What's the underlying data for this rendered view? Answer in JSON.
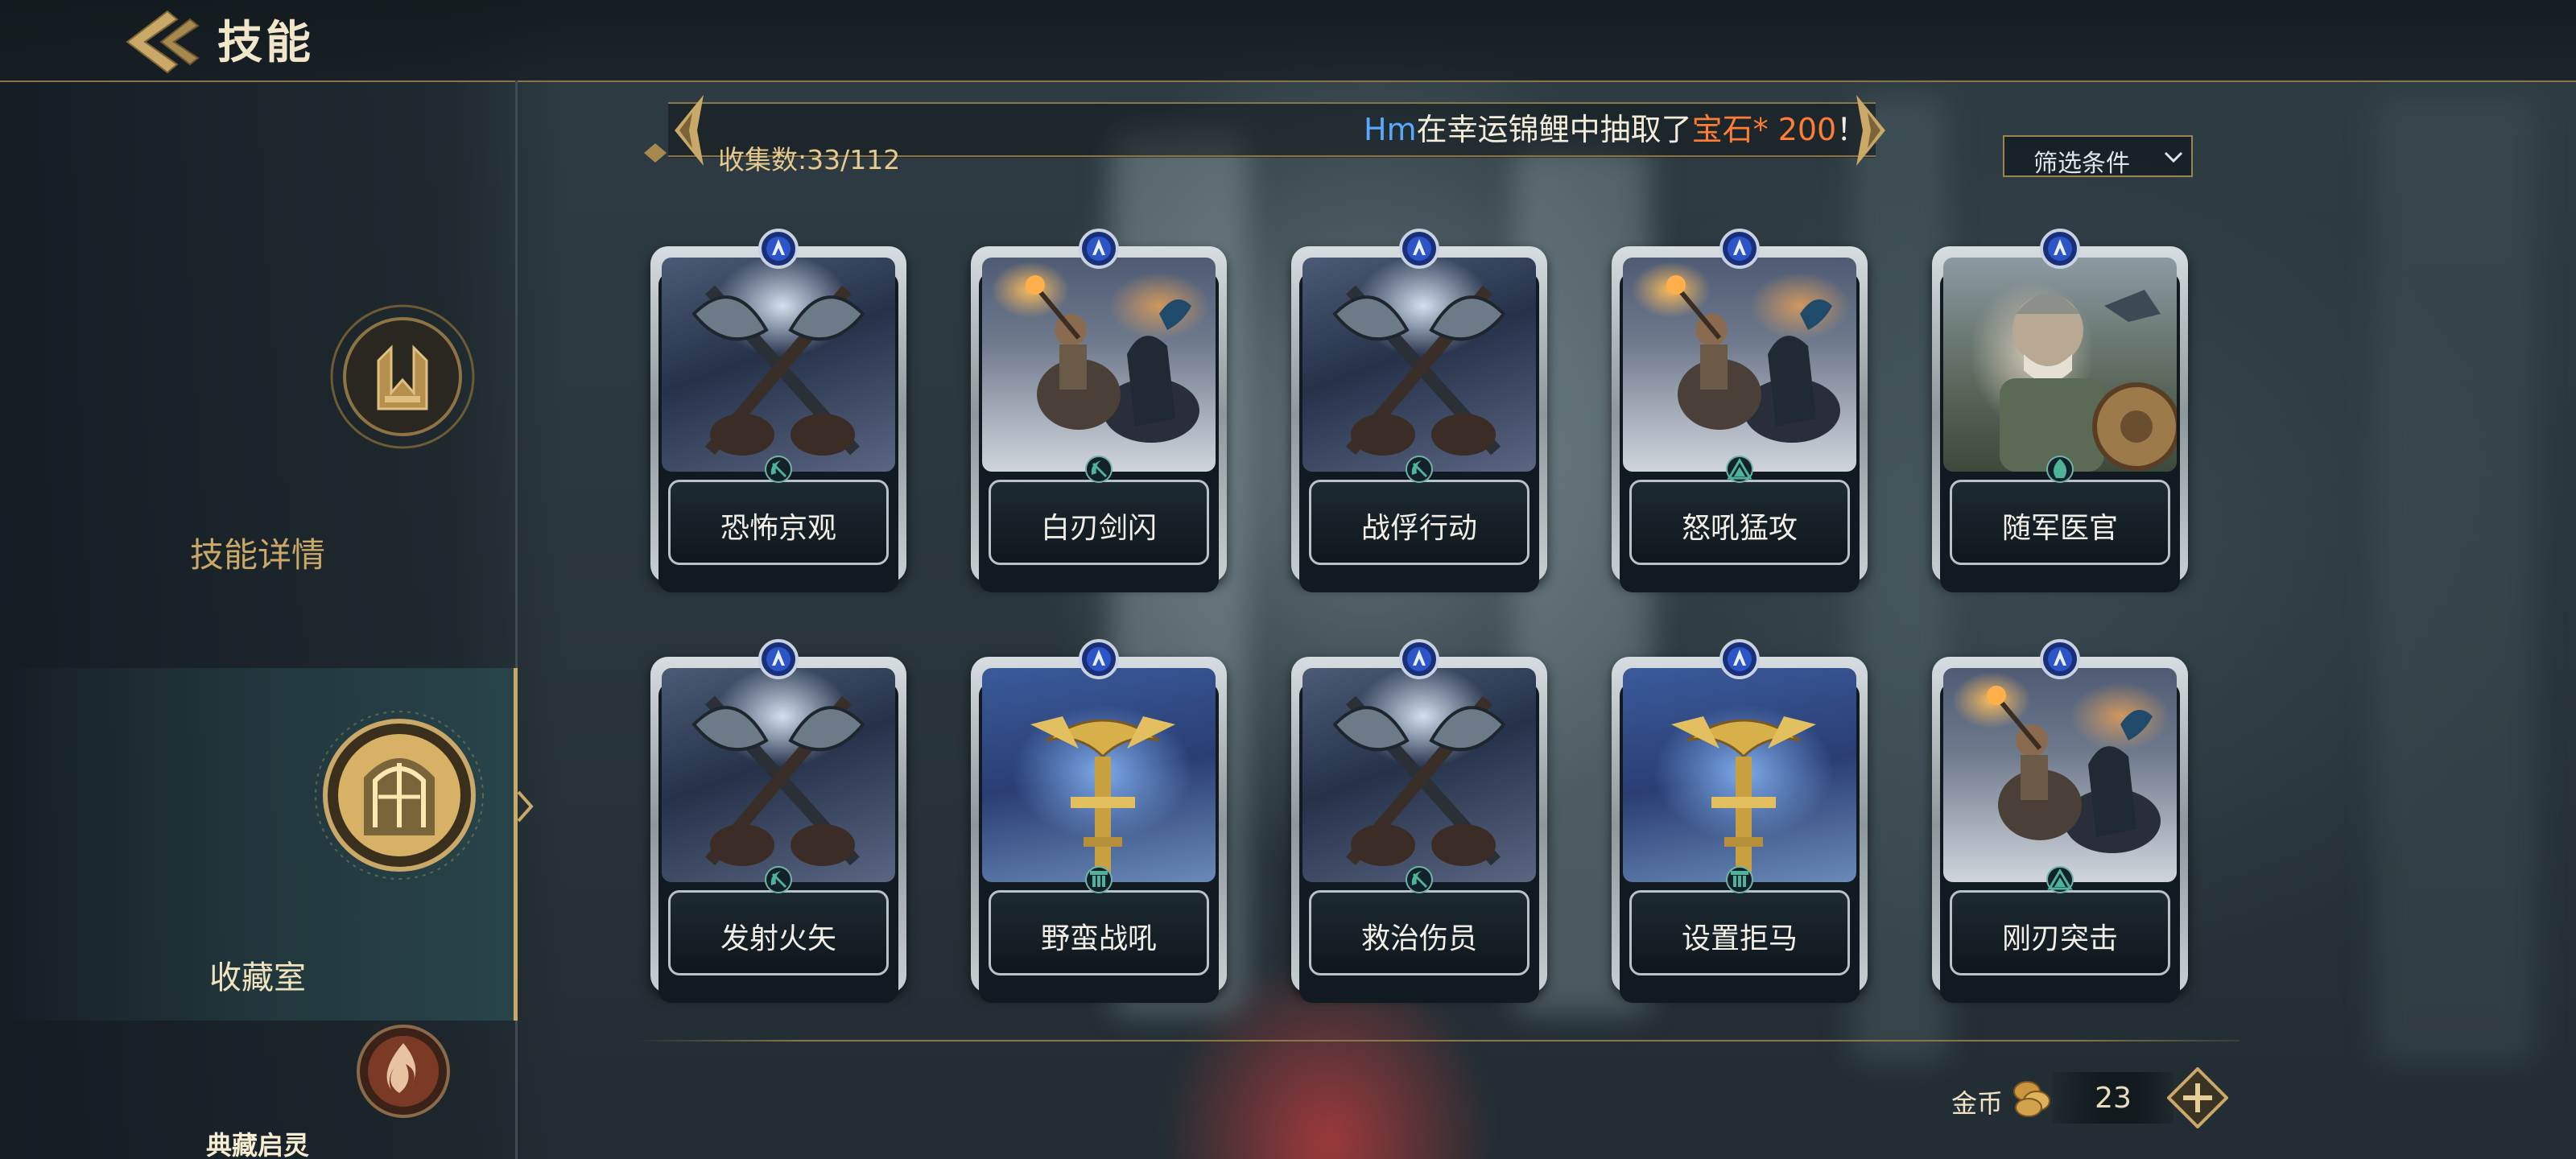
{
  "header": {
    "title": "技能"
  },
  "sidebar": {
    "items": [
      {
        "label": "技能详情",
        "icon": "skill-details-icon"
      },
      {
        "label": "收藏室",
        "icon": "collection-room-icon",
        "active": true
      },
      {
        "label": "典藏启灵",
        "icon": "codex-flame-icon"
      }
    ]
  },
  "ticker": {
    "collect_count": "收集数:33/112",
    "message": {
      "user": "Hm",
      "middle": "在幸运锦鲤中抽取了",
      "reward": "宝石* 200",
      "end": "！"
    }
  },
  "filter": {
    "label": "筛选条件"
  },
  "cards": [
    {
      "name": "恐怖京观",
      "art": "crossed-axes",
      "type_icon": "sickle-icon"
    },
    {
      "name": "白刃剑闪",
      "art": "chariot-warrior",
      "type_icon": "sickle-icon"
    },
    {
      "name": "战俘行动",
      "art": "crossed-axes",
      "type_icon": "sickle-icon"
    },
    {
      "name": "怒吼猛攻",
      "art": "chariot-warrior",
      "type_icon": "pyramid-icon"
    },
    {
      "name": "随军医官",
      "art": "armored-general",
      "type_icon": "flame-badge-icon"
    },
    {
      "name": "发射火矢",
      "art": "crossed-axes",
      "type_icon": "sickle-icon"
    },
    {
      "name": "野蛮战吼",
      "art": "eagle-standard",
      "type_icon": "pillar-icon"
    },
    {
      "name": "救治伤员",
      "art": "crossed-axes",
      "type_icon": "sickle-icon"
    },
    {
      "name": "设置拒马",
      "art": "eagle-standard",
      "type_icon": "pillar-icon"
    },
    {
      "name": "刚刃突击",
      "art": "chariot-warrior",
      "type_icon": "pyramid-icon"
    }
  ],
  "currency": {
    "label": "金币",
    "value": "23",
    "icon": "gold-coins-icon"
  },
  "colors": {
    "accent_gold": "#c9a868",
    "highlight_blue": "#5aa7ff",
    "highlight_orange": "#ff7d34"
  }
}
